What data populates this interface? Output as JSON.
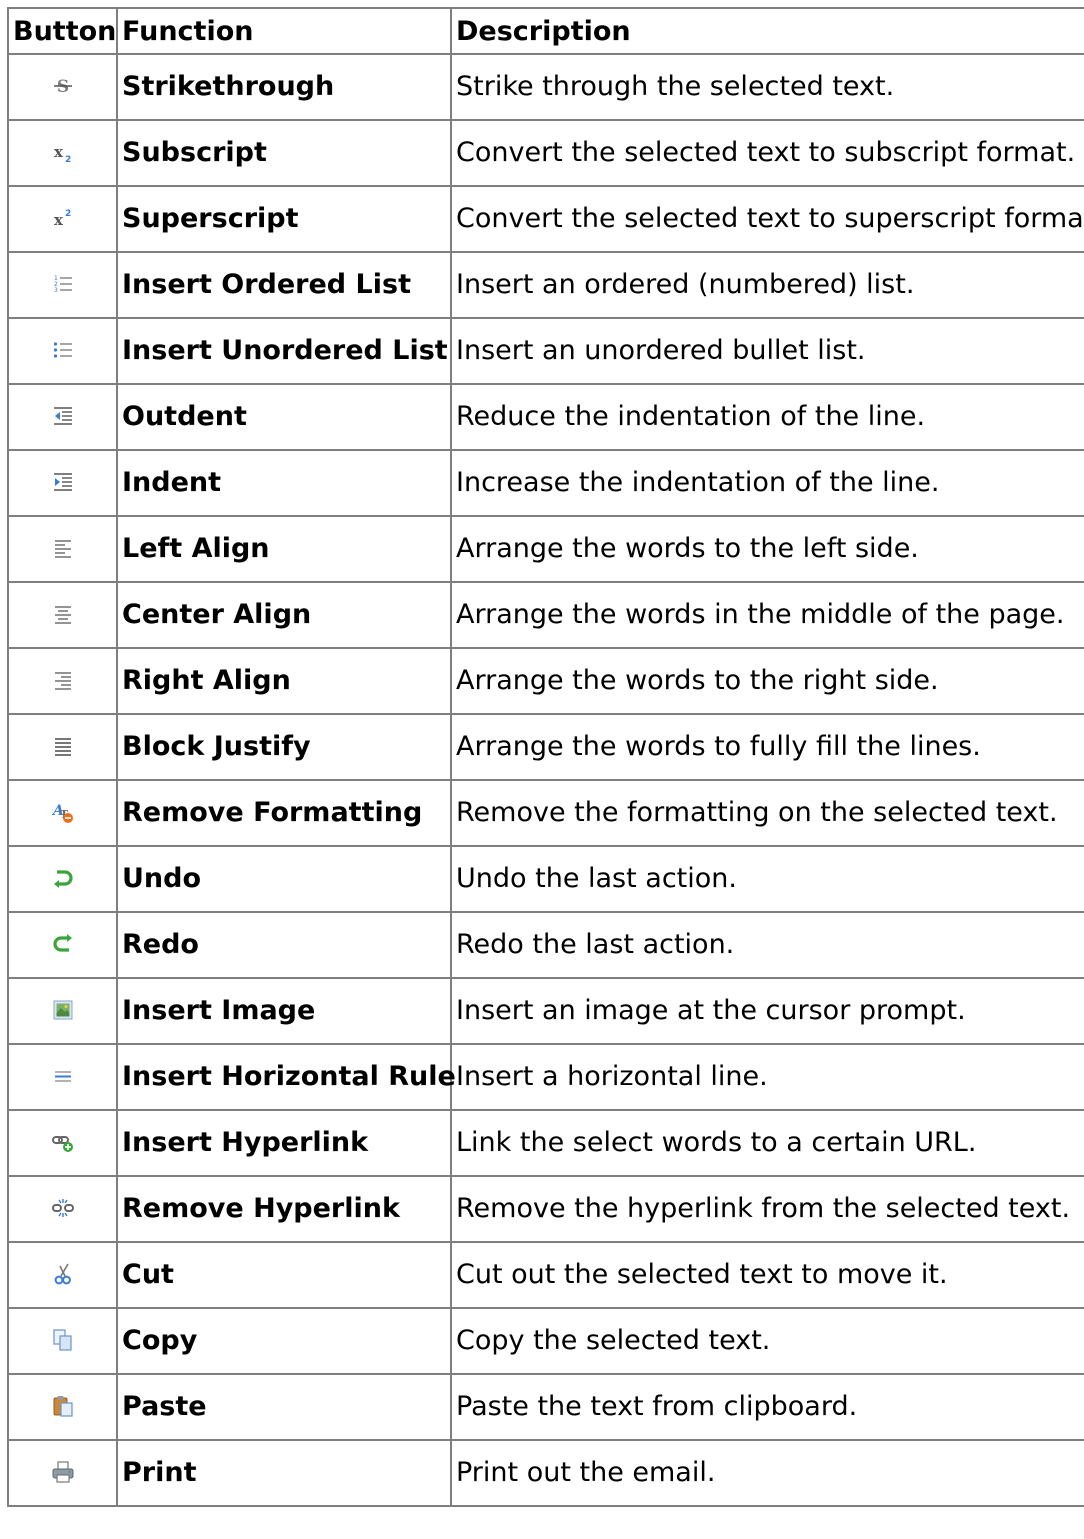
{
  "table": {
    "headers": [
      "Button",
      "Function",
      "Description"
    ],
    "rows": [
      {
        "icon": "strikethrough-icon",
        "function": "Strikethrough",
        "description": "Strike through the selected text."
      },
      {
        "icon": "subscript-icon",
        "function": "Subscript",
        "description": "Convert the selected text to subscript format."
      },
      {
        "icon": "superscript-icon",
        "function": "Superscript",
        "description": "Convert the selected text to superscript format."
      },
      {
        "icon": "ordered-list-icon",
        "function": "Insert Ordered List",
        "description": "Insert an ordered (numbered) list."
      },
      {
        "icon": "unordered-list-icon",
        "function": "Insert Unordered List",
        "description": "Insert an unordered bullet list."
      },
      {
        "icon": "outdent-icon",
        "function": "Outdent",
        "description": "Reduce the indentation of the line."
      },
      {
        "icon": "indent-icon",
        "function": "Indent",
        "description": "Increase the indentation of the line."
      },
      {
        "icon": "align-left-icon",
        "function": "Left Align",
        "description": "Arrange the words to the left side."
      },
      {
        "icon": "align-center-icon",
        "function": "Center Align",
        "description": "Arrange the words in the middle of the page."
      },
      {
        "icon": "align-right-icon",
        "function": "Right Align",
        "description": "Arrange the words to the right side."
      },
      {
        "icon": "align-justify-icon",
        "function": "Block Justify",
        "description": "Arrange the words to fully fill the lines."
      },
      {
        "icon": "remove-formatting-icon",
        "function": "Remove Formatting",
        "description": "Remove the formatting on the selected text."
      },
      {
        "icon": "undo-icon",
        "function": "Undo",
        "description": "Undo the last action."
      },
      {
        "icon": "redo-icon",
        "function": "Redo",
        "description": "Redo the last action."
      },
      {
        "icon": "insert-image-icon",
        "function": "Insert Image",
        "description": "Insert an image at the cursor prompt."
      },
      {
        "icon": "horizontal-rule-icon",
        "function": "Insert Horizontal Rule",
        "description": "Insert a horizontal line."
      },
      {
        "icon": "insert-hyperlink-icon",
        "function": "Insert Hyperlink",
        "description": "Link the select words to a certain URL."
      },
      {
        "icon": "remove-hyperlink-icon",
        "function": "Remove Hyperlink",
        "description": "Remove the hyperlink from the selected text."
      },
      {
        "icon": "cut-icon",
        "function": "Cut",
        "description": "Cut out the selected text to move it."
      },
      {
        "icon": "copy-icon",
        "function": "Copy",
        "description": "Copy the selected text."
      },
      {
        "icon": "paste-icon",
        "function": "Paste",
        "description": "Paste the text from clipboard."
      },
      {
        "icon": "print-icon",
        "function": "Print",
        "description": "Print out the email."
      }
    ]
  },
  "colors": {
    "border": "#7f7f7f",
    "icon_gray": "#666666",
    "icon_blue": "#3a7bd5",
    "icon_green": "#3aa53a",
    "icon_orange": "#e8701a"
  }
}
